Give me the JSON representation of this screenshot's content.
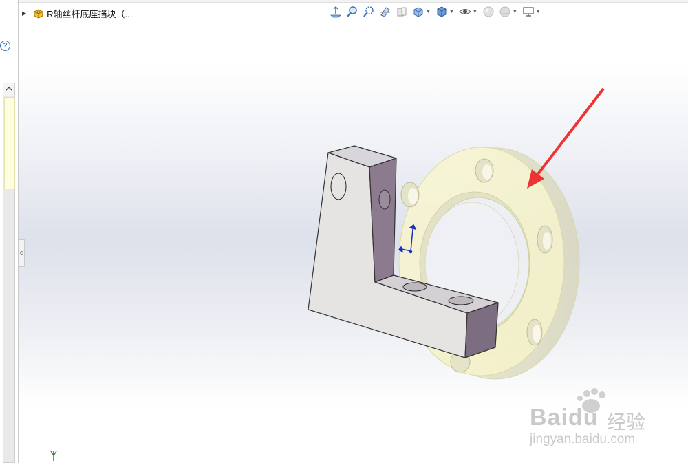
{
  "feature_tree": {
    "part_name": "R轴丝杆底座挡块（..."
  },
  "left_panel": {
    "help_glyph": "?",
    "scroll_up_glyph": "^"
  },
  "toolbar": {
    "buttons": [
      {
        "name": "zoom-to-fit-icon"
      },
      {
        "name": "zoom-to-area-icon"
      },
      {
        "name": "previous-view-icon"
      },
      {
        "name": "section-view-icon"
      },
      {
        "name": "dynamic-annotation-icon"
      },
      {
        "name": "view-orientation-icon"
      },
      {
        "name": "display-style-icon"
      },
      {
        "name": "hide-show-items-icon"
      },
      {
        "name": "edit-appearance-icon"
      },
      {
        "name": "apply-scene-icon"
      },
      {
        "name": "view-settings-icon"
      }
    ]
  },
  "watermark": {
    "brand": "Bai",
    "brand2": "du",
    "cn": "经验",
    "url": "jingyan.baidu.com"
  },
  "colors": {
    "flange": "#f5f2c4",
    "bracket_face": "#e6e4e2",
    "bracket_side": "#8c7a8f",
    "arrow": "#ee3333"
  }
}
